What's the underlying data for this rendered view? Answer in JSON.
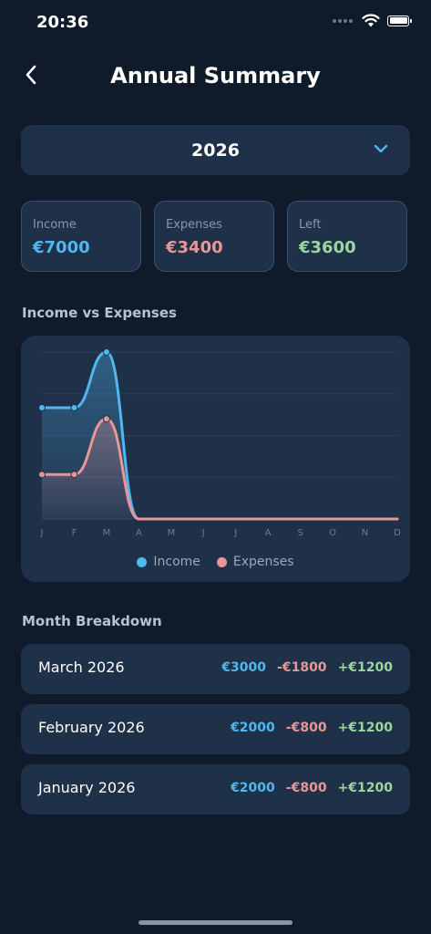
{
  "status_bar": {
    "time": "20:36"
  },
  "header": {
    "title": "Annual Summary"
  },
  "year_selector": {
    "value": "2026"
  },
  "colors": {
    "income": "#4fb8f0",
    "expenses": "#e89797",
    "left": "#9bd69f",
    "card_bg": "#1f3049",
    "background": "#0f1b2a"
  },
  "summary": {
    "income": {
      "label": "Income",
      "value": "€7000"
    },
    "expenses": {
      "label": "Expenses",
      "value": "€3400"
    },
    "left": {
      "label": "Left",
      "value": "€3600"
    }
  },
  "chart_section_title": "Income vs Expenses",
  "chart_data": {
    "type": "area",
    "categories": [
      "J",
      "F",
      "M",
      "A",
      "M",
      "J",
      "J",
      "A",
      "S",
      "O",
      "N",
      "D"
    ],
    "series": [
      {
        "name": "Income",
        "values": [
          2000,
          2000,
          3000,
          0,
          0,
          0,
          0,
          0,
          0,
          0,
          0,
          0
        ]
      },
      {
        "name": "Expenses",
        "values": [
          800,
          800,
          1800,
          0,
          0,
          0,
          0,
          0,
          0,
          0,
          0,
          0
        ]
      }
    ],
    "ylim": [
      0,
      3000
    ],
    "grid": true,
    "legend": "bottom"
  },
  "breakdown_title": "Month Breakdown",
  "months": [
    {
      "name": "March 2026",
      "income": "€3000",
      "expenses": "-€1800",
      "net": "+€1200"
    },
    {
      "name": "February 2026",
      "income": "€2000",
      "expenses": "-€800",
      "net": "+€1200"
    },
    {
      "name": "January 2026",
      "income": "€2000",
      "expenses": "-€800",
      "net": "+€1200"
    }
  ]
}
